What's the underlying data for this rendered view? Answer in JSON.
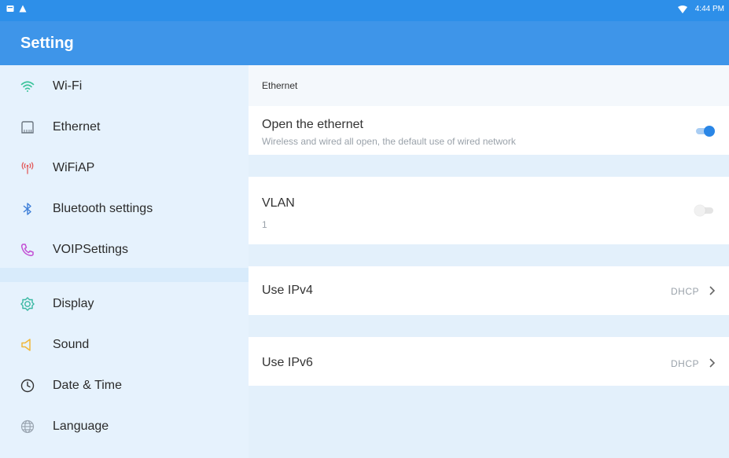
{
  "status_bar": {
    "time": "4:44 PM",
    "icons": [
      "notification-icon",
      "alert-icon",
      "wifi-signal-icon"
    ]
  },
  "app_bar": {
    "title": "Setting"
  },
  "sidebar": {
    "group1": [
      {
        "label": "Wi-Fi",
        "icon": "wifi-icon",
        "color": "#3ac39a"
      },
      {
        "label": "Ethernet",
        "icon": "ethernet-icon",
        "color": "#6b7680"
      },
      {
        "label": "WiFiAP",
        "icon": "hotspot-icon",
        "color": "#e25b5b"
      },
      {
        "label": "Bluetooth settings",
        "icon": "bluetooth-icon",
        "color": "#3d7ed8"
      },
      {
        "label": "VOIPSettings",
        "icon": "phone-icon",
        "color": "#c34fd4"
      }
    ],
    "group2": [
      {
        "label": "Display",
        "icon": "display-icon",
        "color": "#39b8a2"
      },
      {
        "label": "Sound",
        "icon": "sound-icon",
        "color": "#f0b73a"
      },
      {
        "label": "Date & Time",
        "icon": "clock-icon",
        "color": "#333333"
      },
      {
        "label": "Language",
        "icon": "globe-icon",
        "color": "#9aa5b1"
      }
    ]
  },
  "content": {
    "section_title": "Ethernet",
    "open_ethernet": {
      "title": "Open the ethernet",
      "subtitle": "Wireless and wired all open, the default use of wired network",
      "enabled": true
    },
    "vlan": {
      "title": "VLAN",
      "value": "1",
      "enabled": false
    },
    "ipv4": {
      "title": "Use IPv4",
      "value": "DHCP"
    },
    "ipv6": {
      "title": "Use IPv6",
      "value": "DHCP"
    }
  },
  "colors": {
    "accent": "#2a86e6",
    "app_bar": "#3e95e9",
    "status_bar": "#2d8fe9",
    "sidebar_bg": "#e6f2fd",
    "content_bg": "#e3f0fb"
  }
}
